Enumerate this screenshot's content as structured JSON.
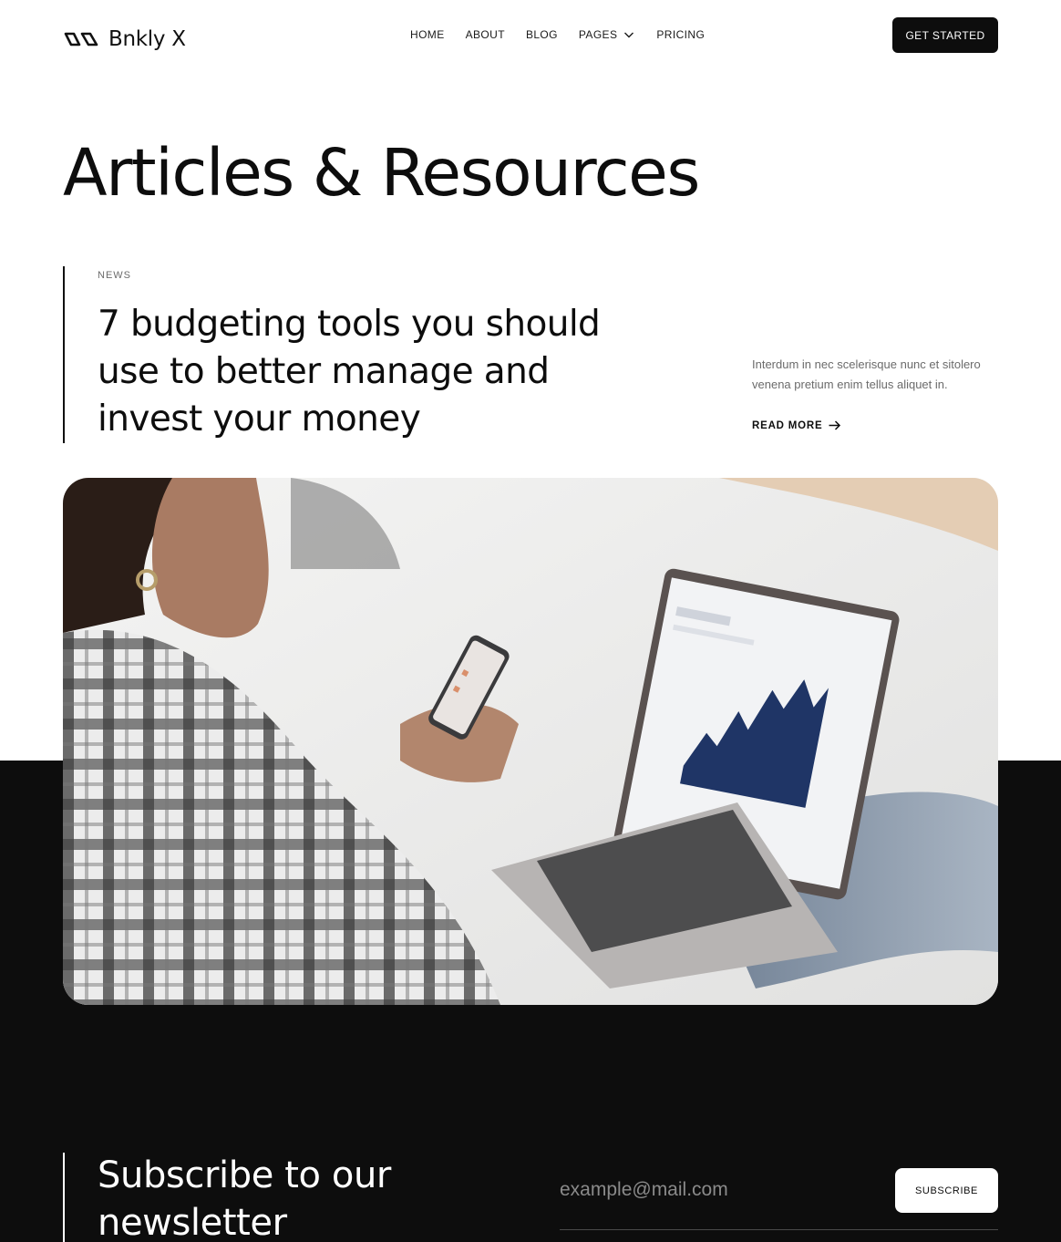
{
  "brand": {
    "name": "Bnkly X",
    "logo_icon": "infinity-logo-icon"
  },
  "nav": {
    "items": [
      {
        "label": "HOME"
      },
      {
        "label": "ABOUT"
      },
      {
        "label": "BLOG"
      },
      {
        "label": "PAGES",
        "icon": "chevron-down-icon"
      },
      {
        "label": "PRICING"
      }
    ],
    "cta_label": "GET STARTED"
  },
  "page": {
    "title": "Articles & Resources"
  },
  "featured": {
    "category": "NEWS",
    "title": "7 budgeting tools you should use to better manage and invest your money",
    "excerpt": "Interdum in nec scelerisque nunc et sitolero venena pretium enim tellus aliquet in.",
    "read_more_label": "READ MORE",
    "read_more_icon": "arrow-right-icon",
    "image_alt": "Woman using phone and laptop"
  },
  "newsletter": {
    "title": "Subscribe to our newsletter",
    "email_placeholder": "example@mail.com",
    "button_label": "SUBSCRIBE"
  },
  "colors": {
    "primary": "#0d0d0d",
    "background": "#ffffff",
    "muted_text": "#6b6b6b"
  }
}
